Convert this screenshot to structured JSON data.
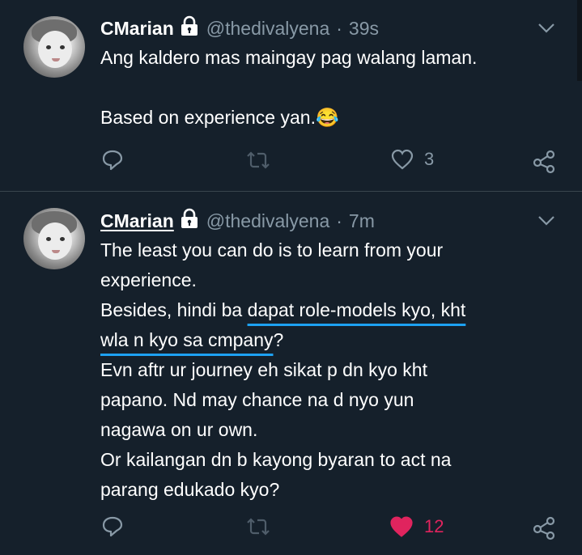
{
  "tweets": [
    {
      "name": "CMarian",
      "handle": "@thedivalyena",
      "separator": "·",
      "time": "39s",
      "lines": [
        "Ang kaldero mas maingay pag walang laman.",
        "",
        "Based on experience yan.😂"
      ],
      "likes": "3",
      "liked": false
    },
    {
      "name": "CMarian",
      "handle": "@thedivalyena",
      "separator": "·",
      "time": "7m",
      "lines": [
        "The least you can do is to learn from your",
        "experience.",
        "Besides, hindi ba ",
        "dapat role-models kyo, kht",
        "wla n kyo sa cmpany",
        "?",
        "Evn aftr ur journey eh sikat p dn kyo kht",
        "papano. Nd may chance na d nyo yun",
        "nagawa on ur own.",
        "Or kailangan dn b kayong byaran to act na",
        "parang edukado kyo?"
      ],
      "likes": "12",
      "liked": true
    }
  ],
  "icons": {
    "lock": "lock-icon",
    "menu": "chevron-down-icon",
    "reply": "reply-icon",
    "retweet": "retweet-icon",
    "like": "heart-icon",
    "share": "share-icon"
  },
  "colors": {
    "background": "#15202b",
    "secondary_text": "#8899a6",
    "like_active": "#e0245e",
    "highlight_underline": "#1da1f2"
  }
}
